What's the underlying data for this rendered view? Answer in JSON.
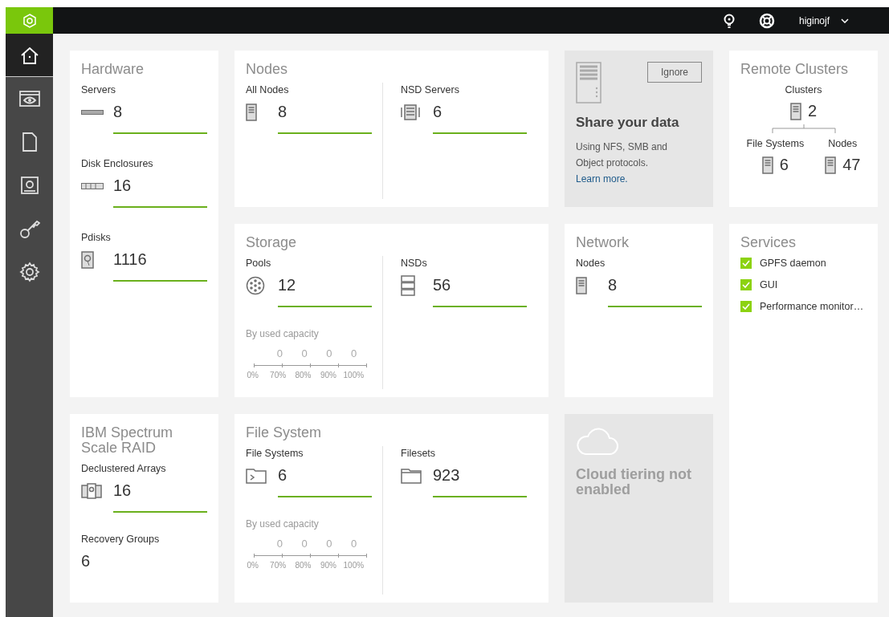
{
  "top_bar": {
    "user": "higinojf"
  },
  "sidebar": {
    "items": [
      {
        "kind": "home",
        "selected": true
      },
      {
        "kind": "monitor",
        "selected": false
      },
      {
        "kind": "files",
        "selected": false
      },
      {
        "kind": "disk",
        "selected": false
      },
      {
        "kind": "key",
        "selected": false
      },
      {
        "kind": "settings",
        "selected": false
      }
    ]
  },
  "hardware": {
    "title": "Hardware",
    "metrics": [
      {
        "label": "Servers",
        "value": "8",
        "kind": "server",
        "underlined": true
      },
      {
        "label": "Disk Enclosures",
        "value": "16",
        "kind": "enclosure",
        "underlined": true
      },
      {
        "label": "Pdisks",
        "value": "1116",
        "kind": "pdisk",
        "underlined": true
      }
    ]
  },
  "nodes": {
    "title": "Nodes",
    "columns": [
      {
        "label": "All Nodes",
        "value": "8",
        "kind": "node"
      },
      {
        "label": "NSD Servers",
        "value": "6",
        "kind": "nsdserver"
      }
    ]
  },
  "share": {
    "button": "Ignore",
    "title": "Share your data",
    "text": "Using NFS, SMB and Object protocols.",
    "link": "Learn more."
  },
  "remote_clusters": {
    "title": "Remote Clusters",
    "clusters": {
      "label": "Clusters",
      "value": "2"
    },
    "file_systems": {
      "label": "File Systems",
      "value": "6"
    },
    "nodes": {
      "label": "Nodes",
      "value": "47"
    }
  },
  "storage": {
    "title": "Storage",
    "columns": [
      {
        "label": "Pools",
        "value": "12",
        "kind": "pool"
      },
      {
        "label": "NSDs",
        "value": "56",
        "kind": "nsd"
      }
    ],
    "capacity": {
      "label": "By used capacity",
      "counts": [
        "0",
        "0",
        "0",
        "0"
      ],
      "ticks": [
        "0%",
        "70%",
        "80%",
        "90%",
        "100%"
      ]
    }
  },
  "network": {
    "title": "Network",
    "metrics": [
      {
        "label": "Nodes",
        "value": "8",
        "kind": "node",
        "underlined": true
      }
    ]
  },
  "services": {
    "title": "Services",
    "items": [
      {
        "label": "GPFS daemon",
        "checked": true
      },
      {
        "label": "GUI",
        "checked": true
      },
      {
        "label": "Performance monitor…",
        "checked": true
      }
    ]
  },
  "raid": {
    "title": "IBM Spectrum Scale RAID",
    "metrics": [
      {
        "label": "Declustered Arrays",
        "value": "16",
        "kind": "array",
        "underlined": true
      },
      {
        "label": "Recovery Groups",
        "value": "6",
        "kind": "plain",
        "underlined": false
      }
    ]
  },
  "file_system": {
    "title": "File System",
    "columns": [
      {
        "label": "File Systems",
        "value": "6",
        "kind": "filesystem"
      },
      {
        "label": "Filesets",
        "value": "923",
        "kind": "folder"
      }
    ],
    "capacity": {
      "label": "By used capacity",
      "counts": [
        "0",
        "0",
        "0",
        "0"
      ],
      "ticks": [
        "0%",
        "70%",
        "80%",
        "90%",
        "100%"
      ]
    }
  },
  "cloud": {
    "text": "Cloud tiering not enabled"
  }
}
